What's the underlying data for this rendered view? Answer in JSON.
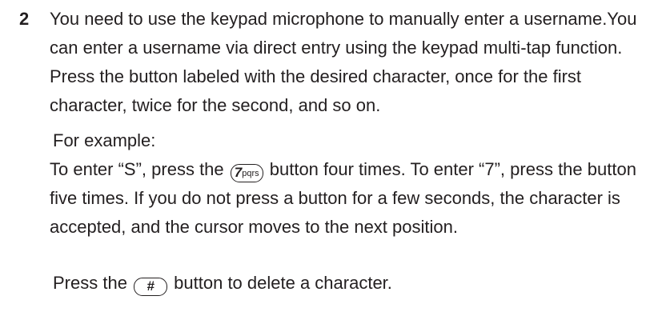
{
  "step": {
    "number": "2",
    "intro": "You need to use the keypad microphone to manually enter a username.You can enter a username via direct entry using the keypad multi-tap function.",
    "instruction": "Press the button labeled with the desired character, once for the first character, twice for the second, and so on."
  },
  "example": {
    "heading": "For example:",
    "text_before_key": "To enter “S”, press the ",
    "key_7_digit": "7",
    "key_7_letters": "pqrs",
    "text_after_key": " button four times. To enter “7”, press the button five times. If you do not press a button for a few seconds, the character is accepted, and the cursor moves to the next position."
  },
  "delete": {
    "text_before_key": "Press the ",
    "key_hash_label": "#",
    "text_after_key": " button to delete a character."
  }
}
